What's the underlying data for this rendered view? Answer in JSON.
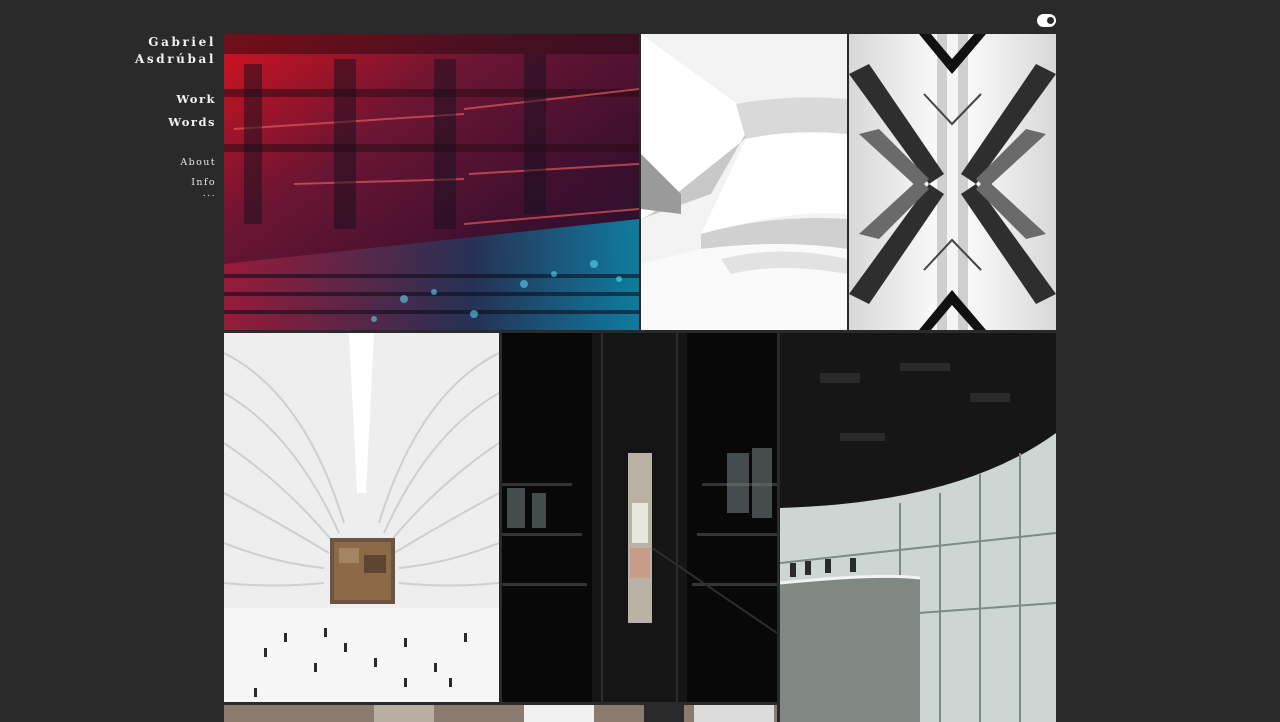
{
  "site": {
    "name": "Gabriel\nAsdrúbal"
  },
  "nav": {
    "main": [
      "Work",
      "Words"
    ],
    "secondary": [
      "About",
      "Info"
    ],
    "more": "..."
  },
  "theme_toggle": {
    "icon": "toggle-icon",
    "state": "on"
  },
  "gallery": {
    "photos": [
      {
        "subject": "theater-auditorium-balconies",
        "palette": [
          "#c0182a",
          "#5b1a4d",
          "#0aa5c4"
        ]
      },
      {
        "subject": "white-spiral-museum-curves",
        "palette": [
          "#ffffff",
          "#dcdcdc",
          "#8a8a8a"
        ]
      },
      {
        "subject": "symmetric-steel-structure-bw",
        "palette": [
          "#e0e0e0",
          "#555555",
          "#111111"
        ]
      },
      {
        "subject": "white-ribbed-hall-with-people",
        "palette": [
          "#f3f3f3",
          "#d6d6d6",
          "#6b5440"
        ]
      },
      {
        "subject": "dark-glass-atrium",
        "palette": [
          "#070707",
          "#3a3a3a",
          "#9aa7a8"
        ]
      },
      {
        "subject": "curved-interior-balconies",
        "palette": [
          "#1a1a1a",
          "#c9d3d0",
          "#6f7a76"
        ]
      },
      {
        "subject": "partial-row-bottom",
        "palette": [
          "#8a7b6e",
          "#dcdcdc",
          "#2b2b2b"
        ]
      }
    ]
  }
}
